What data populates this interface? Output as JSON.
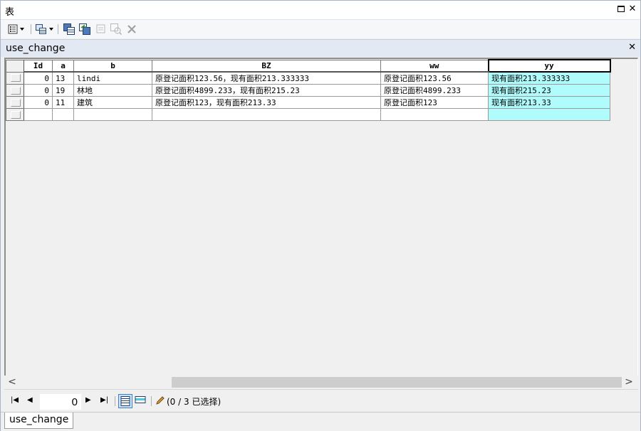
{
  "window": {
    "title": "表"
  },
  "table_tab": {
    "name": "use_change"
  },
  "grid": {
    "columns": [
      "Id",
      "a",
      "b",
      "BZ",
      "ww",
      "yy"
    ],
    "rows": [
      {
        "Id": "0",
        "a": "13",
        "b": "lindi",
        "BZ": "原登记面积123.56，现有面积213.333333",
        "ww": "原登记面积123.56",
        "yy": "现有面积213.333333"
      },
      {
        "Id": "0",
        "a": "19",
        "b": "林地",
        "BZ": "原登记面积4899.233，现有面积215.23",
        "ww": "原登记面积4899.233",
        "yy": "现有面积215.23"
      },
      {
        "Id": "0",
        "a": "11",
        "b": "建筑",
        "BZ": "原登记面积123，现有面积213.33",
        "ww": "原登记面积123",
        "yy": "现有面积213.33"
      }
    ],
    "selected_column": "yy"
  },
  "navigation": {
    "current_record": "0",
    "selection_status": "(0 / 3 已选择)"
  },
  "bottom_tabs": [
    "use_change"
  ],
  "colors": {
    "selected_column_fill": "#b0fcfc",
    "tab_header": "#e2e9f3"
  }
}
